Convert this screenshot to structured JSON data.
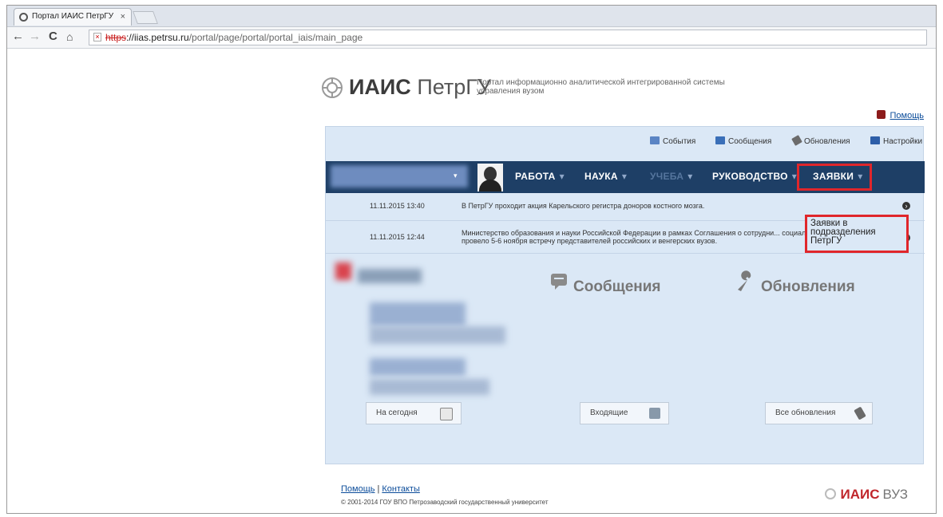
{
  "browser": {
    "tab_title": "Портал ИАИС ПетрГУ",
    "tab_close": "×",
    "back": "←",
    "forward": "→",
    "reload": "C",
    "home": "⌂",
    "url_protocol": "https",
    "url_host": "://iias.petrsu.ru",
    "url_path": "/portal/page/portal/portal_iais/main_page"
  },
  "header": {
    "logo_main": "ИАИС",
    "logo_sub": " ПетрГУ",
    "tagline": "Портал информационно аналитической интегрированной системы управления вузом",
    "help": "Помощь"
  },
  "topmenu": {
    "events": "События",
    "messages": "Сообщения",
    "updates": "Обновления",
    "settings": "Настройки"
  },
  "navbar": {
    "work": "РАБОТА",
    "science": "НАУКА",
    "study": "УЧЕБА",
    "management": "РУКОВОДСТВО",
    "requests": "ЗАЯВКИ",
    "caret": "▾"
  },
  "dropdown": {
    "item": "Заявки в подразделения ПетрГУ"
  },
  "news": [
    {
      "date": "11.11.2015 13:40",
      "text": "В ПетрГУ проходит акция Карельского регистра доноров костного мозга."
    },
    {
      "date": "11.11.2015 12:44",
      "text": "Министерство образования и науки Российской Федерации в рамках Соглашения о сотрудни... социальных ресурсов Венгрии провело 5-6 ноября встречу представителей российских и венгерских вузов."
    }
  ],
  "sections": {
    "messages": "Сообщения",
    "updates": "Обновления"
  },
  "buttons": {
    "today": "На сегодня",
    "incoming": "Входящие",
    "all_updates": "Все обновления"
  },
  "footer": {
    "help": "Помощь",
    "separator": "|",
    "contacts": "Контакты",
    "copyright": "© 2001-2014 ГОУ ВПО Петрозаводский государственный университет",
    "logo_main": "ИАИС",
    "logo_sub": "ВУЗ"
  },
  "colors": {
    "navbar": "#1e3f66",
    "panel": "#dbe8f6",
    "highlight": "#e0262b",
    "link": "#0b4c9a"
  }
}
